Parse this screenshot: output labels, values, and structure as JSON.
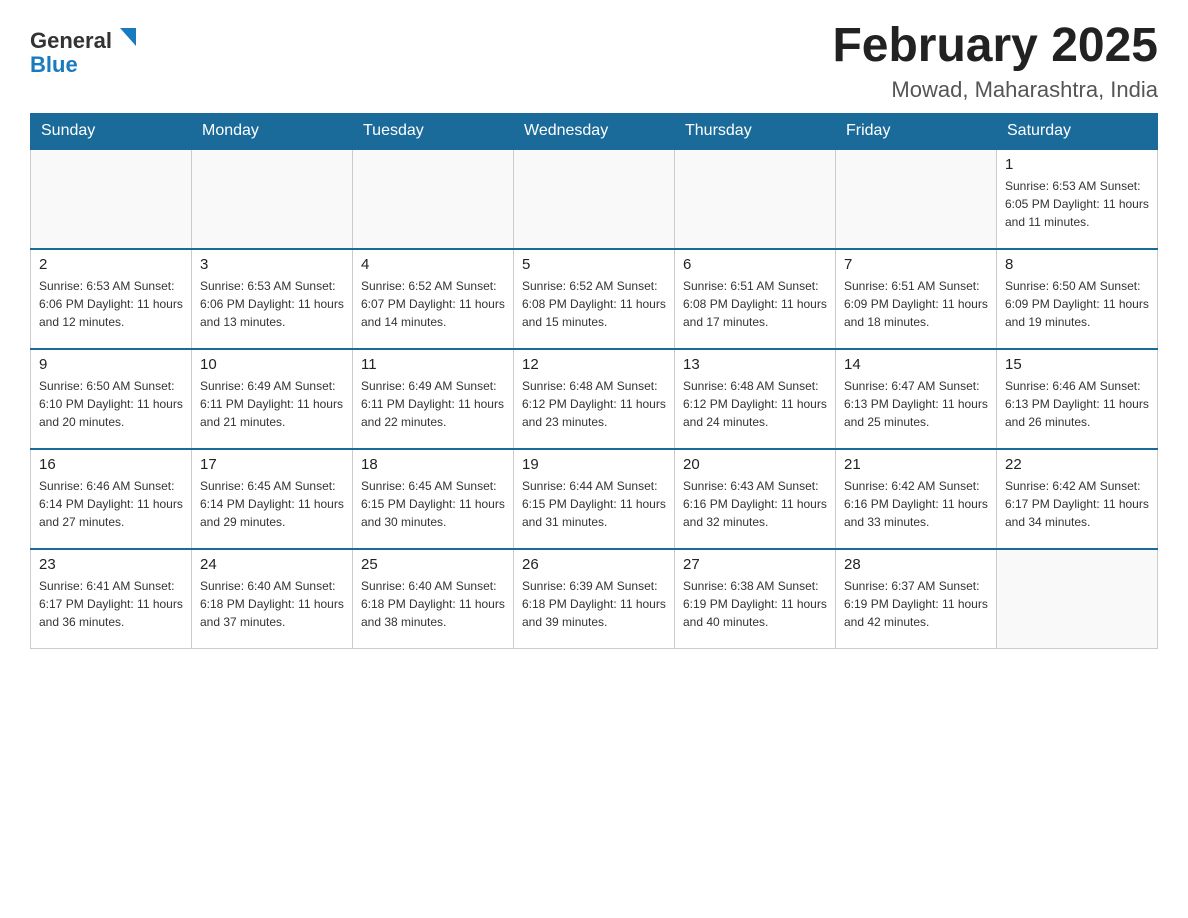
{
  "header": {
    "logo_general": "General",
    "logo_blue": "Blue",
    "month_title": "February 2025",
    "location": "Mowad, Maharashtra, India"
  },
  "days_of_week": [
    "Sunday",
    "Monday",
    "Tuesday",
    "Wednesday",
    "Thursday",
    "Friday",
    "Saturday"
  ],
  "weeks": [
    {
      "days": [
        {
          "num": "",
          "info": ""
        },
        {
          "num": "",
          "info": ""
        },
        {
          "num": "",
          "info": ""
        },
        {
          "num": "",
          "info": ""
        },
        {
          "num": "",
          "info": ""
        },
        {
          "num": "",
          "info": ""
        },
        {
          "num": "1",
          "info": "Sunrise: 6:53 AM\nSunset: 6:05 PM\nDaylight: 11 hours and 11 minutes."
        }
      ]
    },
    {
      "days": [
        {
          "num": "2",
          "info": "Sunrise: 6:53 AM\nSunset: 6:06 PM\nDaylight: 11 hours and 12 minutes."
        },
        {
          "num": "3",
          "info": "Sunrise: 6:53 AM\nSunset: 6:06 PM\nDaylight: 11 hours and 13 minutes."
        },
        {
          "num": "4",
          "info": "Sunrise: 6:52 AM\nSunset: 6:07 PM\nDaylight: 11 hours and 14 minutes."
        },
        {
          "num": "5",
          "info": "Sunrise: 6:52 AM\nSunset: 6:08 PM\nDaylight: 11 hours and 15 minutes."
        },
        {
          "num": "6",
          "info": "Sunrise: 6:51 AM\nSunset: 6:08 PM\nDaylight: 11 hours and 17 minutes."
        },
        {
          "num": "7",
          "info": "Sunrise: 6:51 AM\nSunset: 6:09 PM\nDaylight: 11 hours and 18 minutes."
        },
        {
          "num": "8",
          "info": "Sunrise: 6:50 AM\nSunset: 6:09 PM\nDaylight: 11 hours and 19 minutes."
        }
      ]
    },
    {
      "days": [
        {
          "num": "9",
          "info": "Sunrise: 6:50 AM\nSunset: 6:10 PM\nDaylight: 11 hours and 20 minutes."
        },
        {
          "num": "10",
          "info": "Sunrise: 6:49 AM\nSunset: 6:11 PM\nDaylight: 11 hours and 21 minutes."
        },
        {
          "num": "11",
          "info": "Sunrise: 6:49 AM\nSunset: 6:11 PM\nDaylight: 11 hours and 22 minutes."
        },
        {
          "num": "12",
          "info": "Sunrise: 6:48 AM\nSunset: 6:12 PM\nDaylight: 11 hours and 23 minutes."
        },
        {
          "num": "13",
          "info": "Sunrise: 6:48 AM\nSunset: 6:12 PM\nDaylight: 11 hours and 24 minutes."
        },
        {
          "num": "14",
          "info": "Sunrise: 6:47 AM\nSunset: 6:13 PM\nDaylight: 11 hours and 25 minutes."
        },
        {
          "num": "15",
          "info": "Sunrise: 6:46 AM\nSunset: 6:13 PM\nDaylight: 11 hours and 26 minutes."
        }
      ]
    },
    {
      "days": [
        {
          "num": "16",
          "info": "Sunrise: 6:46 AM\nSunset: 6:14 PM\nDaylight: 11 hours and 27 minutes."
        },
        {
          "num": "17",
          "info": "Sunrise: 6:45 AM\nSunset: 6:14 PM\nDaylight: 11 hours and 29 minutes."
        },
        {
          "num": "18",
          "info": "Sunrise: 6:45 AM\nSunset: 6:15 PM\nDaylight: 11 hours and 30 minutes."
        },
        {
          "num": "19",
          "info": "Sunrise: 6:44 AM\nSunset: 6:15 PM\nDaylight: 11 hours and 31 minutes."
        },
        {
          "num": "20",
          "info": "Sunrise: 6:43 AM\nSunset: 6:16 PM\nDaylight: 11 hours and 32 minutes."
        },
        {
          "num": "21",
          "info": "Sunrise: 6:42 AM\nSunset: 6:16 PM\nDaylight: 11 hours and 33 minutes."
        },
        {
          "num": "22",
          "info": "Sunrise: 6:42 AM\nSunset: 6:17 PM\nDaylight: 11 hours and 34 minutes."
        }
      ]
    },
    {
      "days": [
        {
          "num": "23",
          "info": "Sunrise: 6:41 AM\nSunset: 6:17 PM\nDaylight: 11 hours and 36 minutes."
        },
        {
          "num": "24",
          "info": "Sunrise: 6:40 AM\nSunset: 6:18 PM\nDaylight: 11 hours and 37 minutes."
        },
        {
          "num": "25",
          "info": "Sunrise: 6:40 AM\nSunset: 6:18 PM\nDaylight: 11 hours and 38 minutes."
        },
        {
          "num": "26",
          "info": "Sunrise: 6:39 AM\nSunset: 6:18 PM\nDaylight: 11 hours and 39 minutes."
        },
        {
          "num": "27",
          "info": "Sunrise: 6:38 AM\nSunset: 6:19 PM\nDaylight: 11 hours and 40 minutes."
        },
        {
          "num": "28",
          "info": "Sunrise: 6:37 AM\nSunset: 6:19 PM\nDaylight: 11 hours and 42 minutes."
        },
        {
          "num": "",
          "info": ""
        }
      ]
    }
  ]
}
